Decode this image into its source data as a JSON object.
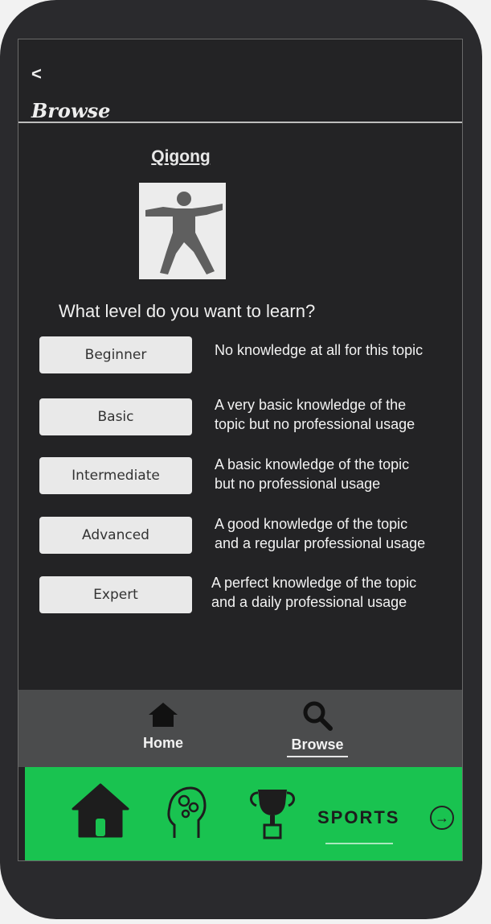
{
  "header": {
    "back_label": "<",
    "title": "Browse"
  },
  "topic": {
    "name": "Qigong"
  },
  "question": "What level do you want to learn?",
  "levels": [
    {
      "label": "Beginner",
      "desc1": "No knowledge at all for this topic",
      "desc2": ""
    },
    {
      "label": "Basic",
      "desc1": "A very basic knowledge of the",
      "desc2": "topic but no professional usage"
    },
    {
      "label": "Intermediate",
      "desc1": "A basic knowledge of the topic",
      "desc2": "but no professional usage"
    },
    {
      "label": "Advanced",
      "desc1": "A good knowledge of the topic",
      "desc2": "and a regular professional usage"
    },
    {
      "label": "Expert",
      "desc1": "A perfect knowledge of the topic",
      "desc2": "and a daily professional usage"
    }
  ],
  "nav": {
    "home_label": "Home",
    "home_icon": "home-icon",
    "browse_label": "Browse",
    "browse_icon": "search-icon",
    "active": "Browse"
  },
  "bottom_bar": {
    "color": "#19c350",
    "icons": [
      "home-icon",
      "brain-gear-icon",
      "trophy-icon"
    ],
    "label": "SPORTS",
    "arrow_icon": "arrow-right-circle-icon"
  }
}
